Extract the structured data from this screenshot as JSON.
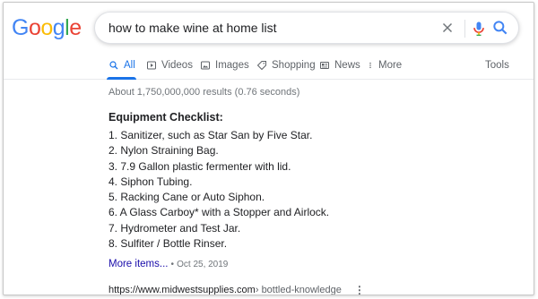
{
  "logo": {
    "letters": [
      "G",
      "o",
      "o",
      "g",
      "l",
      "e"
    ],
    "colors": [
      "#4285f4",
      "#ea4335",
      "#fbbc05",
      "#4285f4",
      "#34a853",
      "#ea4335"
    ]
  },
  "search": {
    "query": "how to make wine at home list"
  },
  "tabs": [
    {
      "label": "All",
      "icon": "search-icon",
      "active": true
    },
    {
      "label": "Videos",
      "icon": "play-icon"
    },
    {
      "label": "Images",
      "icon": "image-icon"
    },
    {
      "label": "Shopping",
      "icon": "tag-icon"
    },
    {
      "label": "News",
      "icon": "newspaper-icon"
    },
    {
      "label": "More",
      "icon": "kebab-icon"
    }
  ],
  "tools_label": "Tools",
  "stats": "About 1,750,000,000 results (0.76 seconds)",
  "snippet": {
    "heading": "Equipment Checklist:",
    "items": [
      "1. Sanitizer, such as Star San by Five Star.",
      "2. Nylon Straining Bag.",
      "3. 7.9 Gallon plastic fermenter with lid.",
      "4. Siphon Tubing.",
      "5. Racking Cane or Auto Siphon.",
      "6. A Glass Carboy* with a Stopper and Airlock.",
      "7. Hydrometer and Test Jar.",
      "8. Sulfiter / Bottle Rinser."
    ],
    "more_label": "More items...",
    "date": "Oct 25, 2019",
    "separator": "•"
  },
  "result_url": {
    "host": "https://www.midwestsupplies.com",
    "path": " › bottled-knowledge"
  },
  "colors": {
    "accent": "#1a73e8",
    "link": "#1a0dab",
    "muted": "#70757a"
  }
}
